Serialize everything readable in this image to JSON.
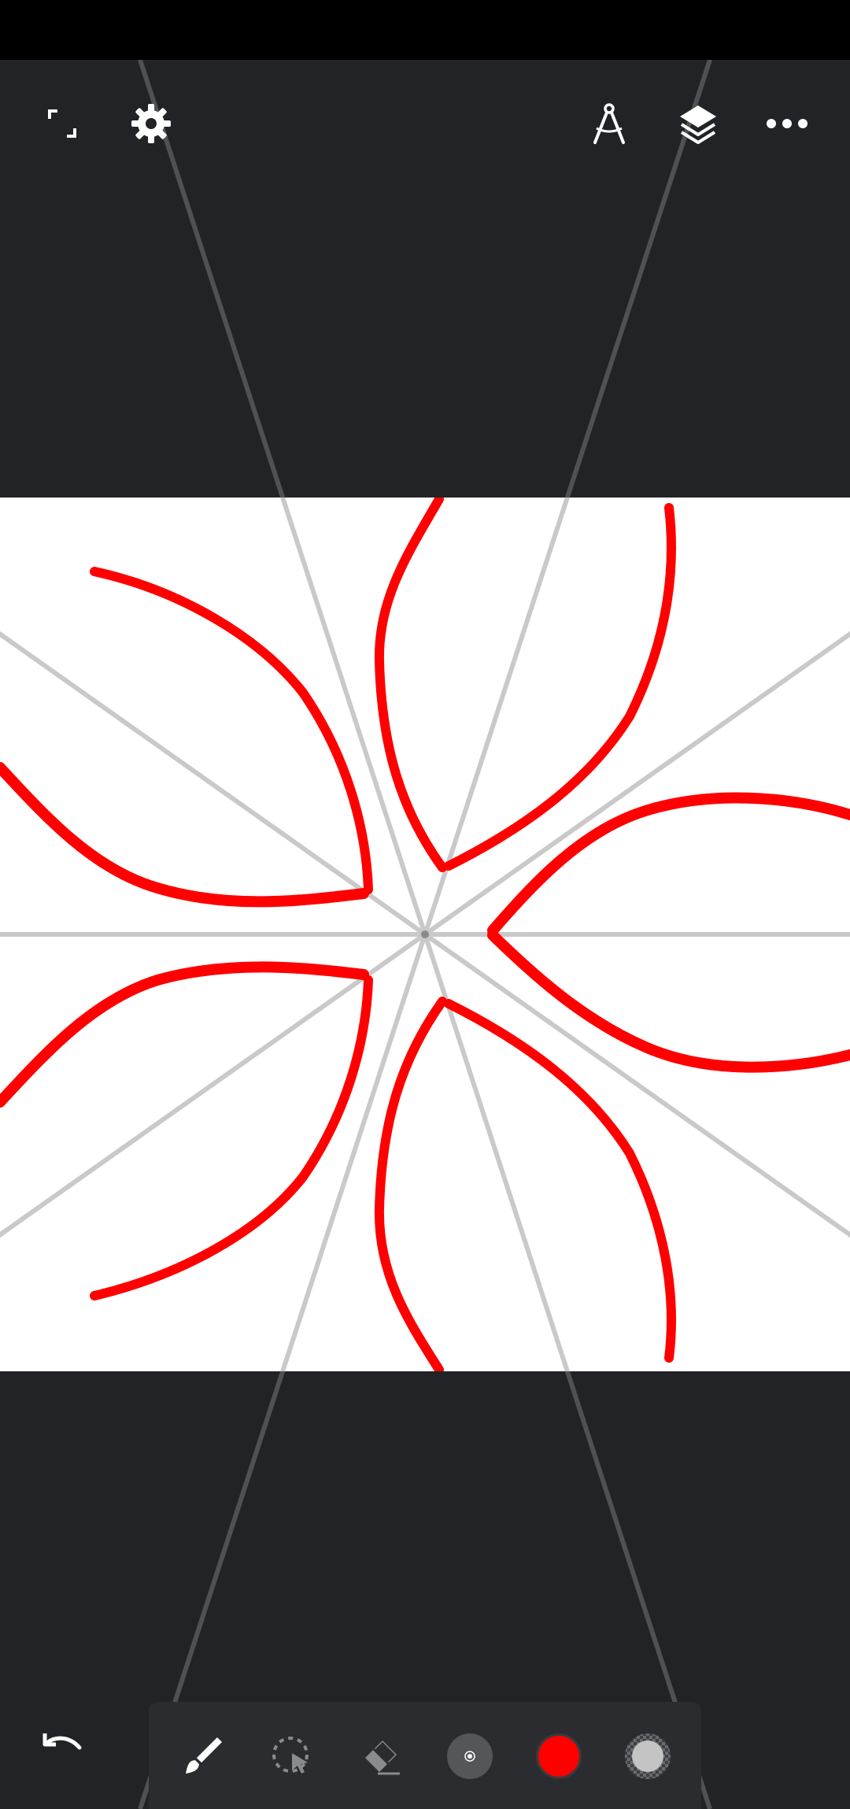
{
  "app": {
    "canvas": {
      "background": "#ffffff",
      "stroke_color": "#ff0000"
    },
    "colors": {
      "chrome": "#222326",
      "status_bar": "#000000",
      "panel": "#2b2c2f",
      "guide_on_canvas": "#c9c9c9",
      "guide_off_canvas": "#505155",
      "icon": "#ffffff",
      "icon_inactive": "#8a8b8e"
    }
  },
  "top_toolbar": {
    "left": [
      {
        "id": "fullscreen",
        "icon": "fullscreen-icon"
      },
      {
        "id": "settings",
        "icon": "gear-icon"
      }
    ],
    "right": [
      {
        "id": "symmetry",
        "icon": "compass-icon"
      },
      {
        "id": "layers",
        "icon": "layers-icon"
      },
      {
        "id": "more",
        "icon": "more-icon"
      }
    ]
  },
  "bottom_toolbar": {
    "undo": {
      "icon": "undo-icon"
    },
    "tools": [
      {
        "id": "brush",
        "icon": "brush-icon",
        "active": true
      },
      {
        "id": "selection",
        "icon": "lasso-select-icon",
        "active": false
      },
      {
        "id": "eraser",
        "icon": "eraser-icon",
        "active": false
      },
      {
        "id": "brush-size",
        "icon": "brush-size-icon"
      },
      {
        "id": "color",
        "icon": "color-swatch-icon",
        "value": "#ff0000"
      },
      {
        "id": "opacity",
        "icon": "opacity-icon"
      }
    ]
  }
}
